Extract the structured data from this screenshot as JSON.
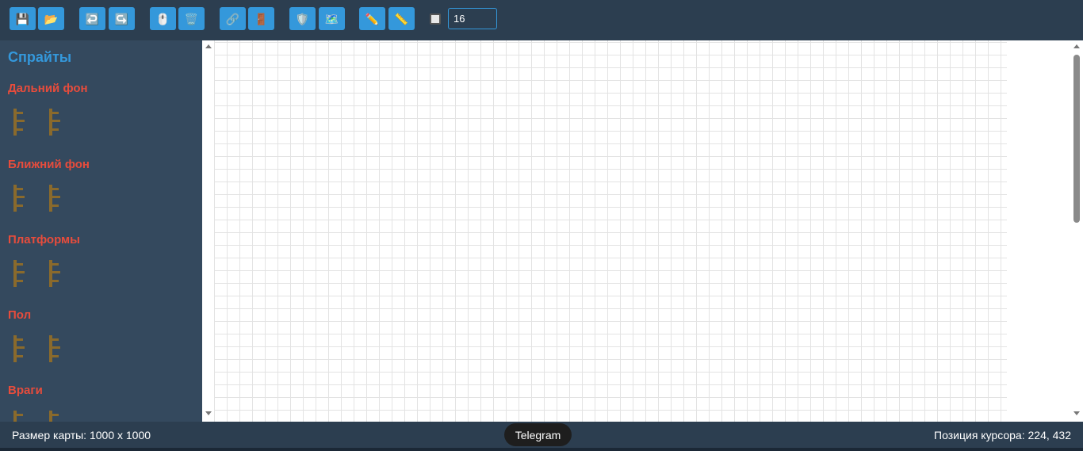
{
  "toolbar": {
    "buttons": [
      {
        "name": "save-button",
        "icon": "floppy-disk-icon",
        "glyph": "💾"
      },
      {
        "name": "open-button",
        "icon": "folder-icon",
        "glyph": "📂"
      },
      {
        "name": "undo-button",
        "icon": "undo-icon",
        "glyph": "↩️"
      },
      {
        "name": "redo-button",
        "icon": "redo-icon",
        "glyph": "↪️"
      },
      {
        "name": "select-tool-button",
        "icon": "mouse-icon",
        "glyph": "🖱️"
      },
      {
        "name": "delete-tool-button",
        "icon": "trash-icon",
        "glyph": "🗑️"
      },
      {
        "name": "link-tool-button",
        "icon": "link-icon",
        "glyph": "🔗"
      },
      {
        "name": "door-tool-button",
        "icon": "door-icon",
        "glyph": "🚪"
      },
      {
        "name": "shield-tool-button",
        "icon": "shield-icon",
        "glyph": "🛡️"
      },
      {
        "name": "map-tool-button",
        "icon": "map-icon",
        "glyph": "🗺️"
      },
      {
        "name": "pencil-tool-button",
        "icon": "pencil-icon",
        "glyph": "✏️"
      },
      {
        "name": "ruler-tool-button",
        "icon": "ruler-icon",
        "glyph": "📏"
      }
    ],
    "grid_size_value": "16"
  },
  "sidebar": {
    "title": "Спрайты",
    "categories": [
      {
        "label": "Дальний фон"
      },
      {
        "label": "Ближний фон"
      },
      {
        "label": "Платформы"
      },
      {
        "label": "Пол"
      },
      {
        "label": "Враги"
      }
    ]
  },
  "status": {
    "map_size": "Размер карты: 1000 x 1000",
    "telegram": "Telegram",
    "cursor_position": "Позиция курсора: 224, 432"
  },
  "colors": {
    "toolbar_bg": "#2c3e50",
    "sidebar_bg": "#34495e",
    "accent": "#3498db",
    "category_title": "#e74c3c"
  }
}
